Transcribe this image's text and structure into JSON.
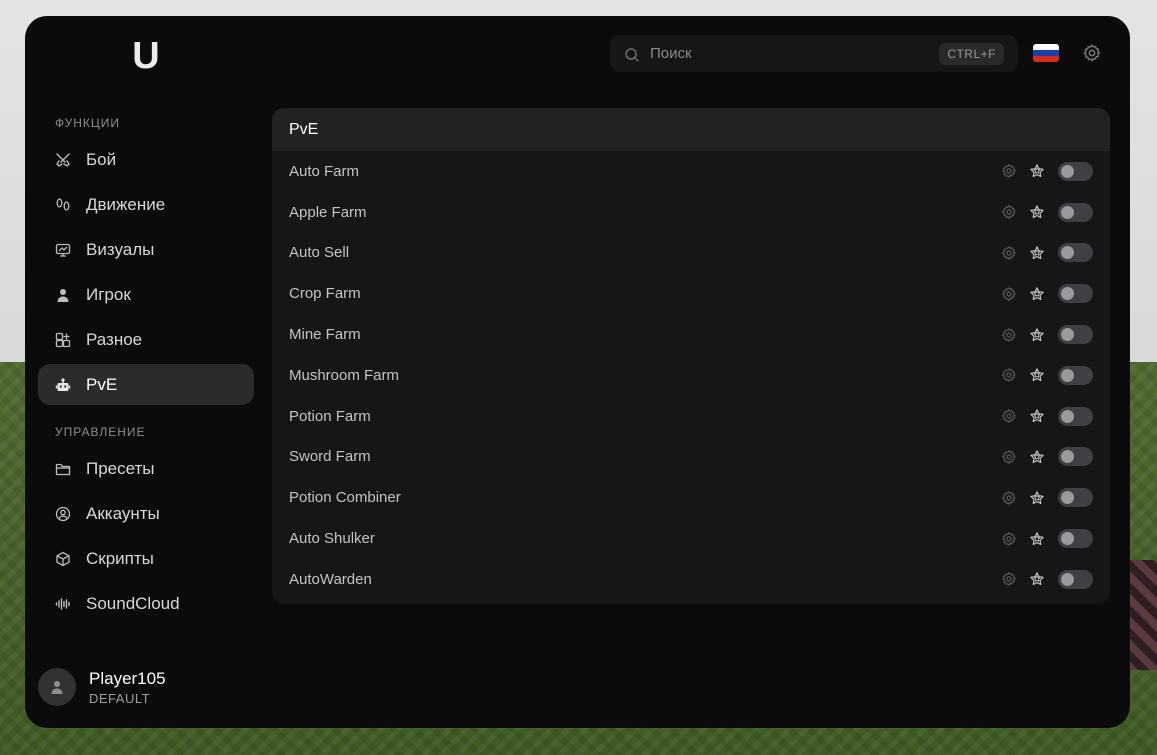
{
  "app": {
    "logo_letter": "U"
  },
  "search": {
    "placeholder": "Поиск",
    "shortcut": "CTRL+F"
  },
  "colors": {
    "window_bg": "#0b0b0c",
    "active_item_bg": "#2b2b2d",
    "panel_bg": "#161617",
    "panel_header_bg": "#222224",
    "toggle_off": "#404044",
    "flag_white": "#ffffff",
    "flag_blue": "#1c3fa8",
    "flag_red": "#d52b1e"
  },
  "sidebar": {
    "functions_title": "ФУНКЦИИ",
    "functions": [
      {
        "label": "Бой",
        "icon": "swords-icon"
      },
      {
        "label": "Движение",
        "icon": "footprints-icon"
      },
      {
        "label": "Визуалы",
        "icon": "monitor-icon"
      },
      {
        "label": "Игрок",
        "icon": "user-icon"
      },
      {
        "label": "Разное",
        "icon": "grid-plus-icon"
      },
      {
        "label": "PvE",
        "icon": "robot-icon",
        "active": true
      }
    ],
    "management_title": "УПРАВЛЕНИЕ",
    "management": [
      {
        "label": "Пресеты",
        "icon": "folder-icon"
      },
      {
        "label": "Аккаунты",
        "icon": "account-circle-icon"
      },
      {
        "label": "Скрипты",
        "icon": "cube-icon"
      },
      {
        "label": "SoundCloud",
        "icon": "waveform-icon"
      }
    ]
  },
  "user": {
    "name": "Player105",
    "role": "DEFAULT"
  },
  "panel": {
    "title": "PvE",
    "modules": [
      {
        "name": "Auto Farm",
        "enabled": false
      },
      {
        "name": "Apple Farm",
        "enabled": false
      },
      {
        "name": "Auto Sell",
        "enabled": false
      },
      {
        "name": "Crop Farm",
        "enabled": false
      },
      {
        "name": "Mine Farm",
        "enabled": false
      },
      {
        "name": "Mushroom Farm",
        "enabled": false
      },
      {
        "name": "Potion Farm",
        "enabled": false
      },
      {
        "name": "Sword Farm",
        "enabled": false
      },
      {
        "name": "Potion Combiner",
        "enabled": false
      },
      {
        "name": "Auto Shulker",
        "enabled": false
      },
      {
        "name": "AutoWarden",
        "enabled": false
      }
    ]
  }
}
